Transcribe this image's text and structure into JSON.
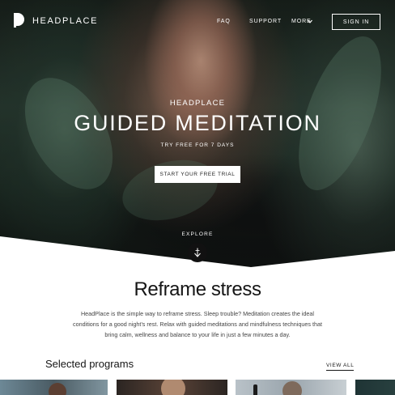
{
  "nav": {
    "brand": "HEADPLACE",
    "links": [
      "FAQ",
      "SUPPORT",
      "MORE"
    ],
    "sign_in": "SIGN IN"
  },
  "hero": {
    "eyebrow": "HEADPLACE",
    "headline": "GUIDED MEDITATION",
    "subline": "TRY FREE FOR 7 DAYS",
    "cta": "START YOUR FREE TRIAL",
    "explore": "EXPLORE"
  },
  "main": {
    "title": "Reframe stress",
    "intro": "HeadPlace is the simple way to reframe stress. Sleep trouble? Meditation creates the ideal conditions for a good night’s rest. Relax with guided meditations and mindfulness techniques that bring calm, wellness and balance to your life in just a few minutes a day.",
    "programs_title": "Selected programs",
    "view_all": "VIEW ALL"
  },
  "icons": {
    "logo": "headplace-logo-icon",
    "more": "chevron-down-icon",
    "explore": "arrow-down-icon"
  },
  "colors": {
    "accent": "#111111",
    "text": "#151515",
    "button_bg": "#ffffff"
  }
}
